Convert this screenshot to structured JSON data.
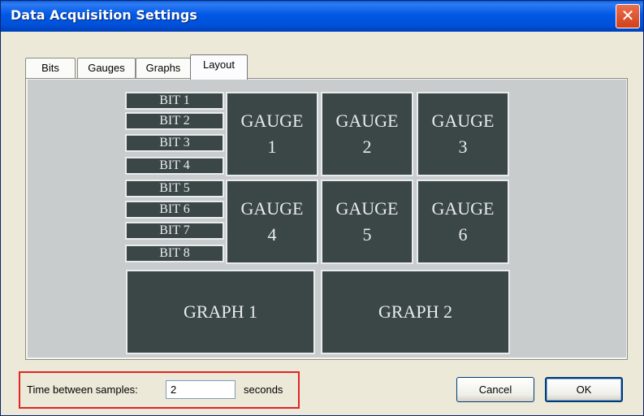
{
  "window": {
    "title": "Data Acquisition Settings",
    "close_glyph": "✕"
  },
  "tabs": [
    {
      "label": "Bits",
      "active": false
    },
    {
      "label": "Gauges",
      "active": false
    },
    {
      "label": "Graphs",
      "active": false
    },
    {
      "label": "Layout",
      "active": true
    }
  ],
  "layout": {
    "bits": [
      "BIT 1",
      "BIT 2",
      "BIT 3",
      "BIT 4",
      "BIT 5",
      "BIT 6",
      "BIT 7",
      "BIT 8"
    ],
    "gauges": [
      {
        "word": "GAUGE",
        "num": "1"
      },
      {
        "word": "GAUGE",
        "num": "2"
      },
      {
        "word": "GAUGE",
        "num": "3"
      },
      {
        "word": "GAUGE",
        "num": "4"
      },
      {
        "word": "GAUGE",
        "num": "5"
      },
      {
        "word": "GAUGE",
        "num": "6"
      }
    ],
    "graphs": [
      "GRAPH 1",
      "GRAPH 2"
    ]
  },
  "sampling": {
    "label": "Time between samples:",
    "value": "2",
    "unit": "seconds"
  },
  "buttons": {
    "cancel": "Cancel",
    "ok": "OK"
  },
  "colors": {
    "block_fill": "#3b4646",
    "canvas": "#c8cccc",
    "highlight_border": "#e22424"
  }
}
